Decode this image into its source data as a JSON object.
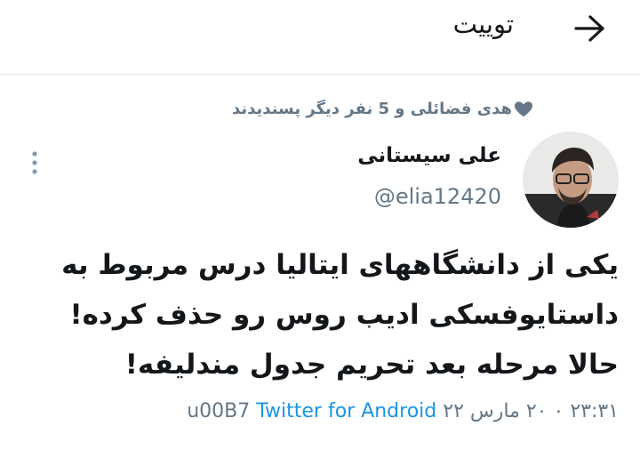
{
  "header": {
    "title": "توییت",
    "back_icon": "arrow-right-icon"
  },
  "social_context": {
    "icon": "heart-icon",
    "text": "هدی فضائلی و 5 نفر دیگر پسندیدند"
  },
  "author": {
    "display_name": "علی سیستانی",
    "handle": "@elia12420"
  },
  "tweet": {
    "text": "یکی از دانشگاههای ایتالیا درس مربوط به\nداستایوفسکی ادیب روس رو حذف کرده!\nحالا مرحله بعد تحریم جدول مندلیفه!",
    "timestamp": "۲۳:۳۱ ۰ ۲۰ مارس ۲۲",
    "device": "u00B7",
    "source": "Twitter for Android"
  },
  "colors": {
    "text": "#14171a",
    "secondary": "#657786",
    "link": "#1b95e0",
    "divider": "#e1e8ed"
  }
}
